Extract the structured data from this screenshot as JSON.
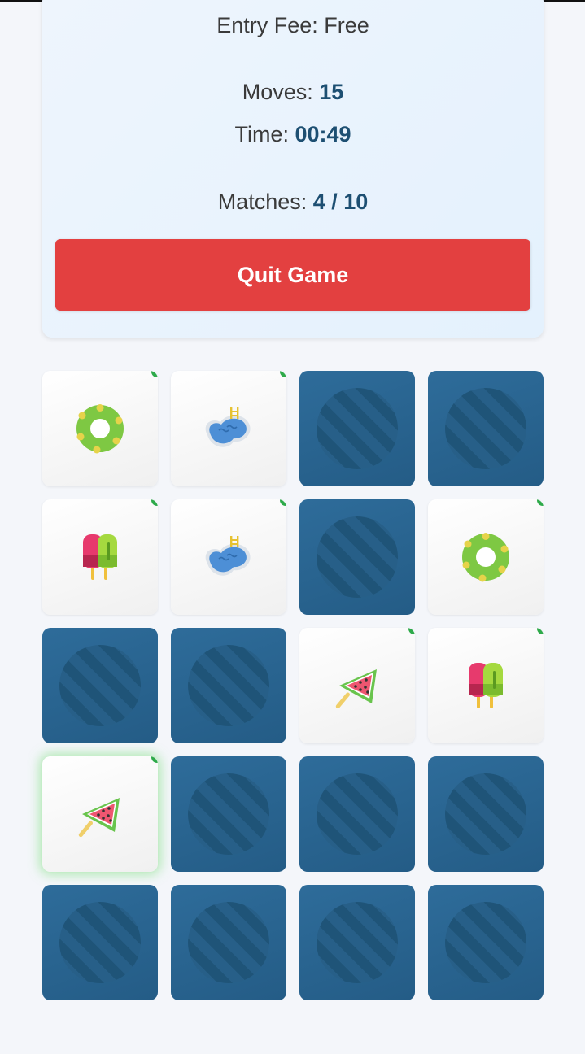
{
  "game_info": {
    "entry_fee_label": "Entry Fee:",
    "entry_fee_value": "Free",
    "moves_label": "Moves:",
    "moves_value": "15",
    "time_label": "Time:",
    "time_value": "00:49",
    "matches_label": "Matches:",
    "matches_value": "4 / 10"
  },
  "actions": {
    "quit_label": "Quit Game"
  },
  "colors": {
    "quit_button": "#e34040",
    "card_back": "#2a6591",
    "value_text": "#1d4f72",
    "matched_corner": "#2eaa4a"
  },
  "board": {
    "rows": 5,
    "columns": 4,
    "cards": [
      {
        "state": "revealed",
        "icon": "swim-ring-icon",
        "matched": true
      },
      {
        "state": "revealed",
        "icon": "pool-icon",
        "matched": true
      },
      {
        "state": "hidden"
      },
      {
        "state": "hidden"
      },
      {
        "state": "revealed",
        "icon": "popsicles-icon",
        "matched": true
      },
      {
        "state": "revealed",
        "icon": "pool-icon",
        "matched": true
      },
      {
        "state": "hidden"
      },
      {
        "state": "revealed",
        "icon": "swim-ring-icon",
        "matched": true
      },
      {
        "state": "hidden"
      },
      {
        "state": "hidden"
      },
      {
        "state": "revealed",
        "icon": "watermelon-icon",
        "matched": true
      },
      {
        "state": "revealed",
        "icon": "popsicles-icon",
        "matched": true
      },
      {
        "state": "revealed",
        "icon": "watermelon-icon",
        "matched": true,
        "selected": true
      },
      {
        "state": "hidden"
      },
      {
        "state": "hidden"
      },
      {
        "state": "hidden"
      },
      {
        "state": "hidden"
      },
      {
        "state": "hidden"
      },
      {
        "state": "hidden"
      },
      {
        "state": "hidden"
      }
    ]
  }
}
